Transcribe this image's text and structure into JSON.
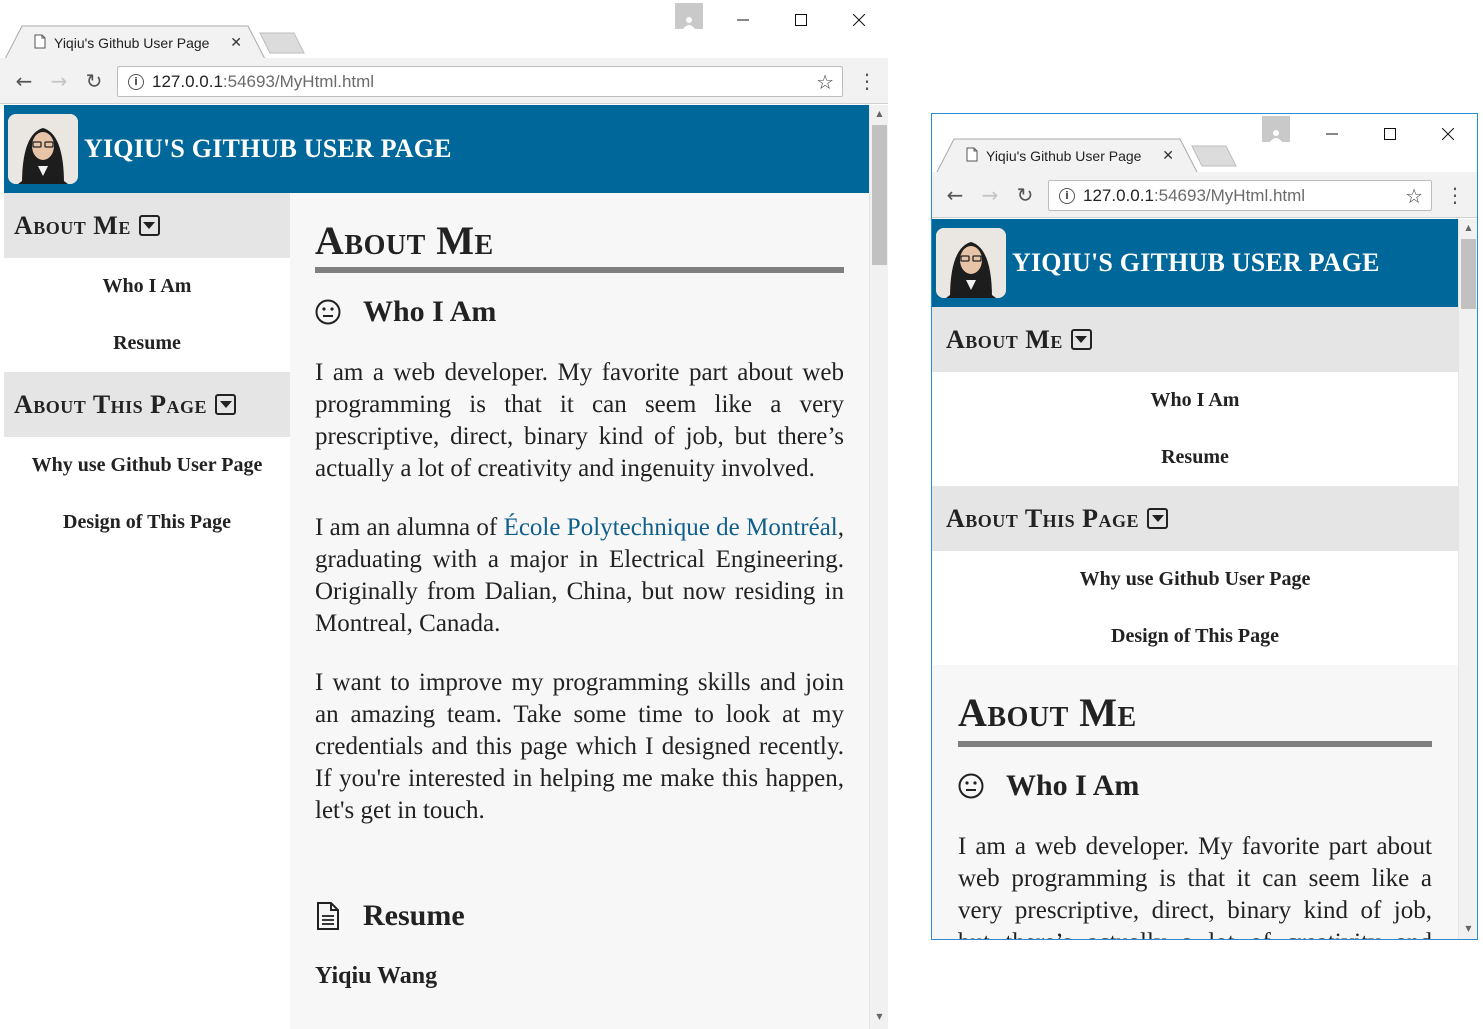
{
  "browser": {
    "tab_title": "Yiqiu's Github User Page",
    "url_host": "127.0.0.1",
    "url_path": ":54693/MyHtml.html"
  },
  "icons": {
    "back": "back-arrow-icon",
    "forward": "forward-arrow-icon",
    "reload": "reload-icon",
    "info": "info-icon",
    "star": "star-icon",
    "menu": "menu-dots-icon",
    "smiley": "neutral-face-icon",
    "document": "document-icon",
    "caret": "caret-down-box-icon"
  },
  "colors": {
    "header_bg": "#00679a",
    "nav_heading_bg": "#e5e5e5",
    "link": "#0f5e8c",
    "rule": "#7f7f7f"
  },
  "site": {
    "title": "YIQIU'S GITHUB USER PAGE",
    "nav": [
      {
        "heading": "About Me",
        "links": [
          "Who I Am",
          "Resume"
        ]
      },
      {
        "heading": "About This Page",
        "links": [
          "Why use Github User Page",
          "Design of This Page"
        ]
      }
    ],
    "main": {
      "title": "About Me",
      "who_heading": "Who I Am",
      "p1": "I am a web developer. My favorite part about web programming is that it can seem like a very prescriptive, direct, binary kind of job, but there’s actually a lot of creativity and ingenuity involved.",
      "p2_before": "I am an alumna of ",
      "p2_link": "École Polytechnique de Montréal",
      "p2_after": ", graduating with a major in Electrical Engineering. Originally from Dalian, China, but now residing in Montreal, Canada.",
      "p3": "I want to improve my programming skills and join an amazing team. Take some time to look at my credentials and this page which I designed recently. If you're interested in helping me make this happen, let's get in touch.",
      "resume_heading": "Resume",
      "resume_name": "Yiqiu Wang"
    }
  }
}
